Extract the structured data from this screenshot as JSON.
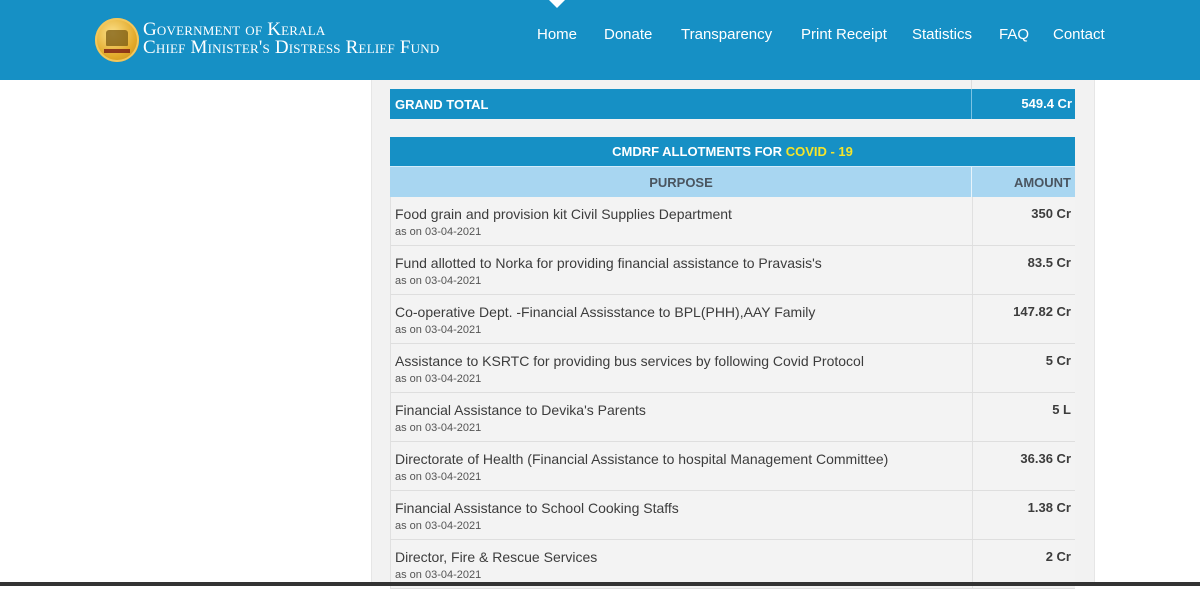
{
  "header": {
    "brand_line1": "Government of Kerala",
    "brand_line2": "Chief Minister's Distress Relief Fund",
    "logo": "kerala-emblem-icon",
    "nav": [
      {
        "label": "Home",
        "active": true
      },
      {
        "label": "Donate"
      },
      {
        "label": "Transparency"
      },
      {
        "label": "Print Receipt"
      },
      {
        "label": "Statistics"
      },
      {
        "label": "FAQ"
      },
      {
        "label": "Contact"
      }
    ]
  },
  "grand_total": {
    "label": "GRAND TOTAL",
    "value": "549.4 Cr"
  },
  "allotments": {
    "title_prefix": "CMDRF ALLOTMENTS FOR",
    "title_highlight": "COVID - 19",
    "columns": [
      "PURPOSE",
      "AMOUNT"
    ],
    "rows": [
      {
        "purpose": "Food grain and provision kit Civil Supplies Department",
        "date": "as on 03-04-2021",
        "amount": "350 Cr"
      },
      {
        "purpose": "Fund allotted to Norka for providing financial assistance to Pravasis's",
        "date": "as on 03-04-2021",
        "amount": "83.5 Cr"
      },
      {
        "purpose": "Co-operative Dept. -Financial Assisstance to BPL(PHH),AAY Family",
        "date": "as on 03-04-2021",
        "amount": "147.82 Cr"
      },
      {
        "purpose": "Assistance to KSRTC for providing bus services by following Covid Protocol",
        "date": "as on 03-04-2021",
        "amount": "5 Cr"
      },
      {
        "purpose": "Financial Assistance to Devika's Parents",
        "date": "as on 03-04-2021",
        "amount": "5 L"
      },
      {
        "purpose": "Directorate of Health (Financial Assistance to hospital Management Committee)",
        "date": "as on 03-04-2021",
        "amount": "36.36 Cr"
      },
      {
        "purpose": "Financial Assistance to School Cooking Staffs",
        "date": "as on 03-04-2021",
        "amount": "1.38 Cr"
      },
      {
        "purpose": "Director, Fire & Rescue Services",
        "date": "as on 03-04-2021",
        "amount": "2 Cr"
      }
    ]
  }
}
